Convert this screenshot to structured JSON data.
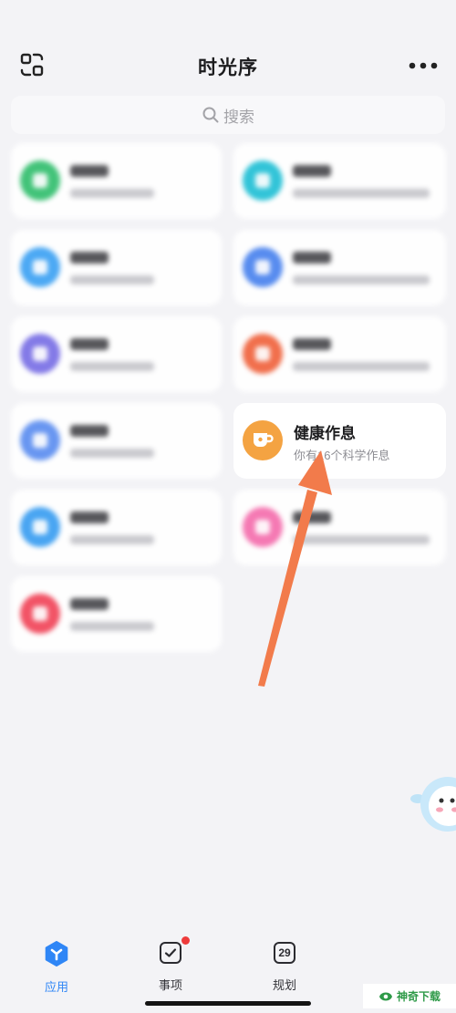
{
  "header": {
    "title": "时光序",
    "scan_icon": "scan-icon",
    "more_icon": "more-dots-icon"
  },
  "search": {
    "placeholder": "搜索",
    "icon": "search-icon"
  },
  "apps": [
    {
      "icon": "app-icon",
      "icon_color": "#34c06f",
      "blurred": true
    },
    {
      "icon": "app-icon",
      "icon_color": "#22c1d6",
      "blurred": true
    },
    {
      "icon": "app-icon",
      "icon_color": "#3fa3f4",
      "blurred": true
    },
    {
      "icon": "app-icon",
      "icon_color": "#4b84ef",
      "blurred": true
    },
    {
      "icon": "app-icon",
      "icon_color": "#7a70e6",
      "blurred": true
    },
    {
      "icon": "app-icon",
      "icon_color": "#f1643e",
      "blurred": true
    },
    {
      "icon": "app-icon",
      "icon_color": "#5d8ff1",
      "blurred": true
    },
    {
      "icon": "cup-icon",
      "icon_color": "#f4a342",
      "blurred": false,
      "title": "健康作息",
      "subtitle": "你有16个科学作息"
    },
    {
      "icon": "app-icon",
      "icon_color": "#3b9ff2",
      "blurred": true
    },
    {
      "icon": "app-icon",
      "icon_color": "#f66fae",
      "blurred": true
    },
    {
      "icon": "app-icon",
      "icon_color": "#f2465a",
      "blurred": true
    }
  ],
  "annotation_arrow": {
    "color": "#f27b4b"
  },
  "tabs": [
    {
      "label": "应用",
      "icon": "apps-hexagon-icon",
      "active": true
    },
    {
      "label": "事项",
      "icon": "check-square-icon",
      "badge": true
    },
    {
      "label": "规划",
      "icon": "calendar-icon",
      "icon_text": "29"
    }
  ],
  "colors": {
    "accent": "#2f86f6",
    "badge": "#ee3b3b",
    "background": "#f3f3f6",
    "card": "#ffffff"
  },
  "watermark": {
    "text": "神奇下载",
    "color": "#2e9a48"
  }
}
